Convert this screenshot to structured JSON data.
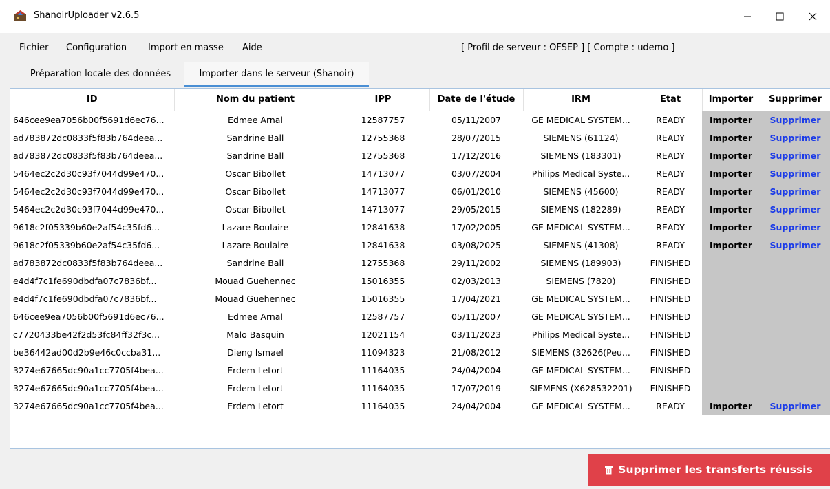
{
  "window": {
    "title": "ShanoirUploader v2.6.5",
    "min_glyph": "—",
    "max_glyph": "☐",
    "close_glyph": "✕"
  },
  "menu": {
    "items": [
      "Fichier",
      "Configuration",
      "Import en masse",
      "Aide"
    ],
    "server_info": "[ Profil de serveur : OFSEP ] [ Compte : udemo ]"
  },
  "tabs": [
    {
      "label": "Préparation locale des données"
    },
    {
      "label": "Importer dans le serveur (Shanoir)"
    }
  ],
  "table": {
    "headers": [
      "ID",
      "Nom du patient",
      "IPP",
      "Date de l'étude",
      "IRM",
      "Etat",
      "Importer",
      "Supprimer"
    ],
    "rows": [
      {
        "id": "646cee9ea7056b00f5691d6ec76...",
        "name": "Edmee Arnal",
        "ipp": "12587757",
        "date": "05/11/2007",
        "irm": "GE MEDICAL SYSTEM...",
        "state": "READY",
        "import": "Importer",
        "delete": "Supprimer"
      },
      {
        "id": "ad783872dc0833f5f83b764deea...",
        "name": "Sandrine Ball",
        "ipp": "12755368",
        "date": "28/07/2015",
        "irm": "SIEMENS (61124)",
        "state": "READY",
        "import": "Importer",
        "delete": "Supprimer"
      },
      {
        "id": "ad783872dc0833f5f83b764deea...",
        "name": "Sandrine Ball",
        "ipp": "12755368",
        "date": "17/12/2016",
        "irm": "SIEMENS (183301)",
        "state": "READY",
        "import": "Importer",
        "delete": "Supprimer"
      },
      {
        "id": "5464ec2c2d30c93f7044d99e470...",
        "name": "Oscar Bibollet",
        "ipp": "14713077",
        "date": "03/07/2004",
        "irm": "Philips Medical Syste...",
        "state": "READY",
        "import": "Importer",
        "delete": "Supprimer"
      },
      {
        "id": "5464ec2c2d30c93f7044d99e470...",
        "name": "Oscar Bibollet",
        "ipp": "14713077",
        "date": "06/01/2010",
        "irm": "SIEMENS (45600)",
        "state": "READY",
        "import": "Importer",
        "delete": "Supprimer"
      },
      {
        "id": "5464ec2c2d30c93f7044d99e470...",
        "name": "Oscar Bibollet",
        "ipp": "14713077",
        "date": "29/05/2015",
        "irm": "SIEMENS (182289)",
        "state": "READY",
        "import": "Importer",
        "delete": "Supprimer"
      },
      {
        "id": "9618c2f05339b60e2af54c35fd6...",
        "name": "Lazare Boulaire",
        "ipp": "12841638",
        "date": "17/02/2005",
        "irm": "GE MEDICAL SYSTEM...",
        "state": "READY",
        "import": "Importer",
        "delete": "Supprimer"
      },
      {
        "id": "9618c2f05339b60e2af54c35fd6...",
        "name": "Lazare Boulaire",
        "ipp": "12841638",
        "date": "03/08/2025",
        "irm": "SIEMENS (41308)",
        "state": "READY",
        "import": "Importer",
        "delete": "Supprimer"
      },
      {
        "id": "ad783872dc0833f5f83b764deea...",
        "name": "Sandrine Ball",
        "ipp": "12755368",
        "date": "29/11/2002",
        "irm": "SIEMENS (189903)",
        "state": "FINISHED",
        "import": "",
        "delete": ""
      },
      {
        "id": "e4d4f7c1fe690dbdfa07c7836bf...",
        "name": "Mouad Guehennec",
        "ipp": "15016355",
        "date": "02/03/2013",
        "irm": "SIEMENS (7820)",
        "state": "FINISHED",
        "import": "",
        "delete": ""
      },
      {
        "id": "e4d4f7c1fe690dbdfa07c7836bf...",
        "name": "Mouad Guehennec",
        "ipp": "15016355",
        "date": "17/04/2021",
        "irm": "GE MEDICAL SYSTEM...",
        "state": "FINISHED",
        "import": "",
        "delete": ""
      },
      {
        "id": "646cee9ea7056b00f5691d6ec76...",
        "name": "Edmee Arnal",
        "ipp": "12587757",
        "date": "05/11/2007",
        "irm": "GE MEDICAL SYSTEM...",
        "state": "FINISHED",
        "import": "",
        "delete": ""
      },
      {
        "id": "c7720433be42f2d53fc84ff32f3c...",
        "name": "Malo Basquin",
        "ipp": "12021154",
        "date": "03/11/2023",
        "irm": "Philips Medical Syste...",
        "state": "FINISHED",
        "import": "",
        "delete": ""
      },
      {
        "id": "be36442ad00d2b9e46c0ccba31...",
        "name": "Dieng Ismael",
        "ipp": "11094323",
        "date": "21/08/2012",
        "irm": "SIEMENS (32626(Peu...",
        "state": "FINISHED",
        "import": "",
        "delete": ""
      },
      {
        "id": "3274e67665dc90a1cc7705f4bea...",
        "name": "Erdem Letort",
        "ipp": "11164035",
        "date": "24/04/2004",
        "irm": "GE MEDICAL SYSTEM...",
        "state": "FINISHED",
        "import": "",
        "delete": ""
      },
      {
        "id": "3274e67665dc90a1cc7705f4bea...",
        "name": "Erdem Letort",
        "ipp": "11164035",
        "date": "17/07/2019",
        "irm": "SIEMENS (X628532201)",
        "state": "FINISHED",
        "import": "",
        "delete": ""
      },
      {
        "id": "3274e67665dc90a1cc7705f4bea...",
        "name": "Erdem Letort",
        "ipp": "11164035",
        "date": "24/04/2004",
        "irm": "GE MEDICAL SYSTEM...",
        "state": "READY",
        "import": "Importer",
        "delete": "Supprimer"
      }
    ]
  },
  "purge_button": {
    "label": "Supprimer les transferts réussis",
    "icon": "trash-icon",
    "color": "#e04149"
  }
}
